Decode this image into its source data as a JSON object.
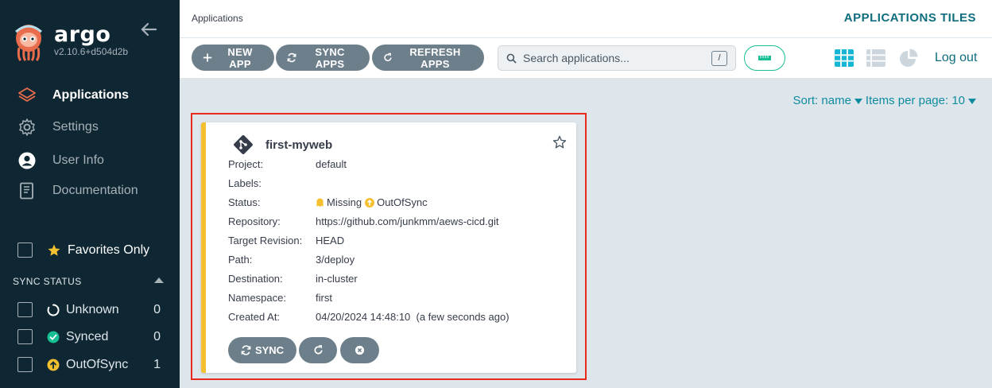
{
  "sidebar": {
    "brand": "argo",
    "version": "v2.10.6+d504d2b",
    "nav": [
      {
        "label": "Applications",
        "icon": "layers-icon",
        "active": true
      },
      {
        "label": "Settings",
        "icon": "gear-icon"
      },
      {
        "label": "User Info",
        "icon": "user-icon"
      },
      {
        "label": "Documentation",
        "icon": "book-icon"
      }
    ],
    "favorites_label": "Favorites Only",
    "sync_status_header": "SYNC STATUS",
    "sync_filters": [
      {
        "label": "Unknown",
        "count": "0",
        "color": "#ffffff"
      },
      {
        "label": "Synced",
        "count": "0",
        "color": "#18be94"
      },
      {
        "label": "OutOfSync",
        "count": "1",
        "color": "#f4c030"
      }
    ]
  },
  "topbar": {
    "breadcrumb": "Applications",
    "title": "APPLICATIONS TILES"
  },
  "toolbar": {
    "new_app": "NEW APP",
    "sync_apps": "SYNC APPS",
    "refresh_apps": "REFRESH APPS",
    "search_placeholder": "Search applications...",
    "search_shortcut": "/",
    "logout": "Log out"
  },
  "sort": {
    "sort_label": "Sort: name",
    "items_label": "Items per page: 10"
  },
  "colors": {
    "accent": "#0f6d7e",
    "out_of_sync": "#f4c030",
    "highlight": "#e8291c"
  },
  "app": {
    "name": "first-myweb",
    "fields": [
      {
        "key": "Project:",
        "value": "default"
      },
      {
        "key": "Labels:",
        "value": ""
      },
      {
        "key": "Status:",
        "value": ""
      },
      {
        "key": "Repository:",
        "value": "https://github.com/junkmm/aews-cicd.git"
      },
      {
        "key": "Target Revision:",
        "value": "HEAD"
      },
      {
        "key": "Path:",
        "value": "3/deploy"
      },
      {
        "key": "Destination:",
        "value": "in-cluster"
      },
      {
        "key": "Namespace:",
        "value": "first"
      },
      {
        "key": "Created At:",
        "value": "04/20/2024 14:48:10  (a few seconds ago)"
      }
    ],
    "health": "Missing",
    "sync": "OutOfSync",
    "sync_button": "SYNC"
  }
}
